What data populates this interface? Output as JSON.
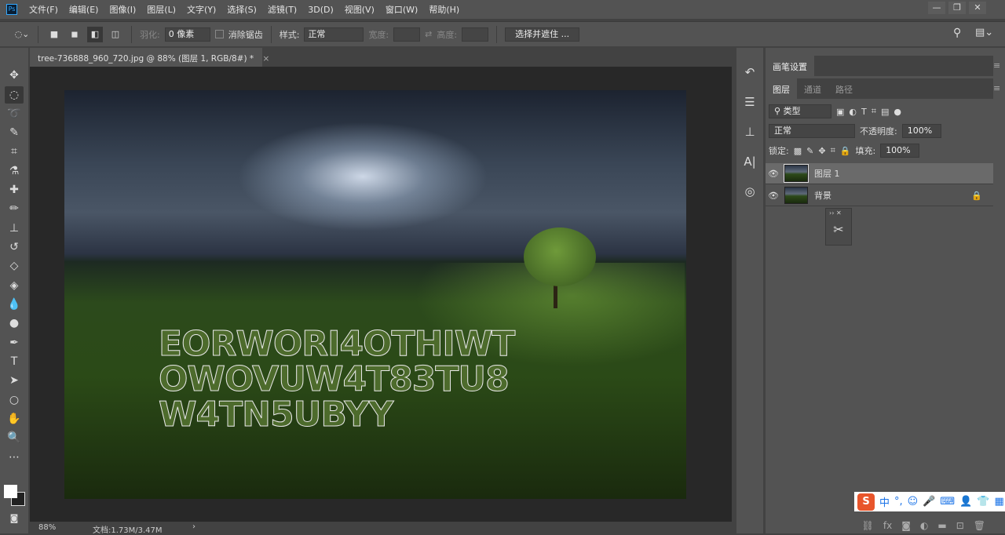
{
  "app": {
    "logo": "Ps"
  },
  "menu": [
    "文件(F)",
    "编辑(E)",
    "图像(I)",
    "图层(L)",
    "文字(Y)",
    "选择(S)",
    "滤镜(T)",
    "3D(D)",
    "视图(V)",
    "窗口(W)",
    "帮助(H)"
  ],
  "window_controls": {
    "minimize": "—",
    "restore": "❐",
    "close": "✕"
  },
  "options": {
    "feather_label": "羽化:",
    "feather_value": "0 像素",
    "antialias_label": "消除锯齿",
    "style_label": "样式:",
    "style_value": "正常",
    "width_label": "宽度:",
    "height_label": "高度:",
    "select_mask_button": "选择并遮住 ..."
  },
  "document": {
    "tab_title": "tree-736888_960_720.jpg @ 88% (图层 1, RGB/8#) *",
    "close": "×",
    "selection_text": [
      "EORWORI4OTHIWT",
      "OWOVUW4T83TU8",
      "W4TN5UBYY"
    ]
  },
  "status": {
    "zoom": "88%",
    "doc_info": "文档:1.73M/3.47M",
    "arrow": "›"
  },
  "panels": {
    "brush_settings_tab": "画笔设置",
    "tabs": [
      "图层",
      "通道",
      "路径"
    ],
    "filter_kind": "类型",
    "blend_mode": "正常",
    "opacity_label": "不透明度:",
    "opacity_value": "100%",
    "lock_label": "锁定:",
    "fill_label": "填充:",
    "fill_value": "100%",
    "layers": [
      {
        "name": "图层 1",
        "selected": true
      },
      {
        "name": "背景",
        "locked": true
      }
    ]
  },
  "ime": {
    "logo": "S",
    "lang": "中",
    "punct": "°,"
  }
}
